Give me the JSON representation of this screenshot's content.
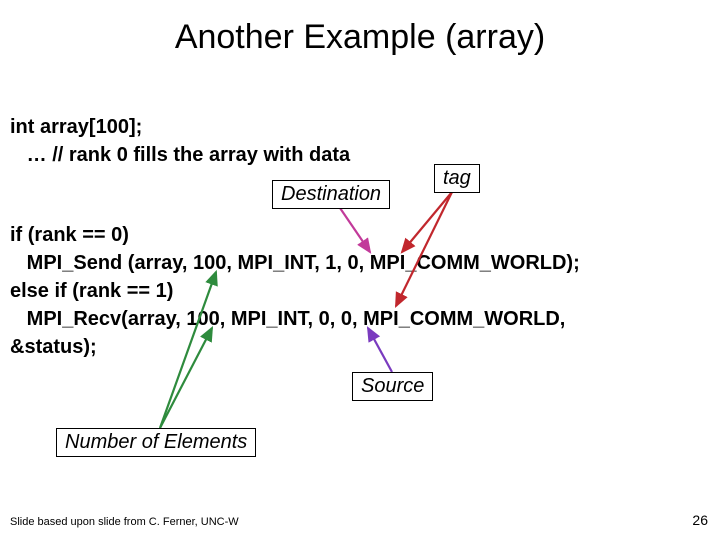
{
  "title": "Another Example (array)",
  "code": {
    "l1": "int array[100];",
    "l2": "   … // rank 0 fills the array with data",
    "l3": "if (rank == 0)",
    "l4": "   MPI_Send (array, 100, MPI_INT, 1, 0, MPI_COMM_WORLD);",
    "l5": "else if (rank == 1)",
    "l6": "   MPI_Recv(array, 100, MPI_INT, 0, 0, MPI_COMM_WORLD,",
    "l7": "&status);"
  },
  "labels": {
    "destination": "Destination",
    "tag": "tag",
    "source": "Source",
    "num_elements": "Number of Elements"
  },
  "footer": "Slide based upon slide from C. Ferner, UNC-W",
  "pagenum": "26"
}
